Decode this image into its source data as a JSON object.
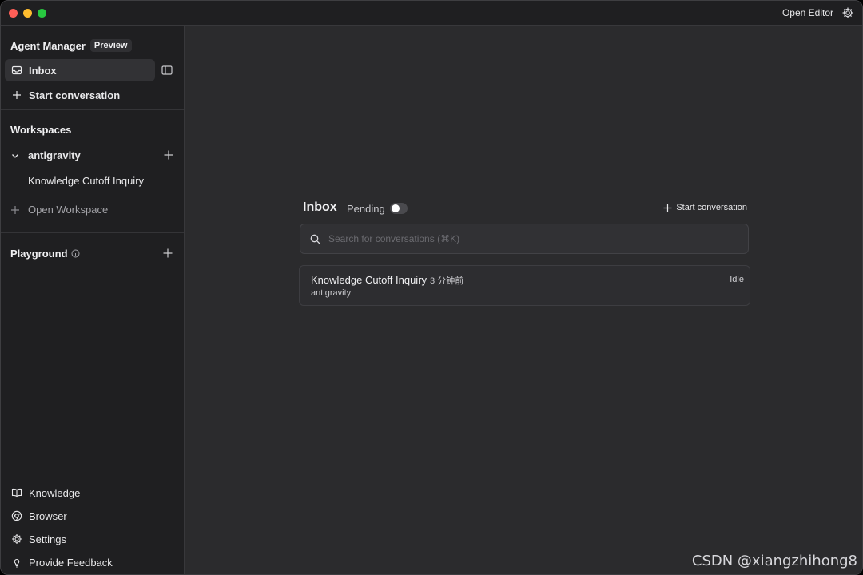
{
  "titlebar": {
    "open_editor_label": "Open Editor"
  },
  "sidebar": {
    "brand_title": "Agent Manager",
    "preview_badge": "Preview",
    "inbox_label": "Inbox",
    "start_conversation_label": "Start conversation",
    "workspaces_title": "Workspaces",
    "workspace_name": "antigravity",
    "workspace_conversation": "Knowledge Cutoff Inquiry",
    "open_workspace_label": "Open Workspace",
    "playground_title": "Playground",
    "bottom_items": [
      {
        "label": "Knowledge",
        "icon": "book-icon"
      },
      {
        "label": "Browser",
        "icon": "chrome-icon"
      },
      {
        "label": "Settings",
        "icon": "gear-icon"
      },
      {
        "label": "Provide Feedback",
        "icon": "lightbulb-icon"
      }
    ]
  },
  "main": {
    "inbox_title": "Inbox",
    "pending_label": "Pending",
    "pending_enabled": false,
    "start_conversation_label": "Start conversation",
    "search_placeholder": "Search for conversations (⌘K)",
    "conversations": [
      {
        "title": "Knowledge Cutoff Inquiry",
        "time": "3 分钟前",
        "workspace": "antigravity",
        "status": "Idle"
      }
    ]
  },
  "watermark": "CSDN @xiangzhihong8",
  "colors": {
    "background": "#2b2b2d",
    "sidebar": "#1f1f21",
    "traffic_red": "#ff5f57",
    "traffic_yellow": "#febc2e",
    "traffic_green": "#28c840"
  }
}
